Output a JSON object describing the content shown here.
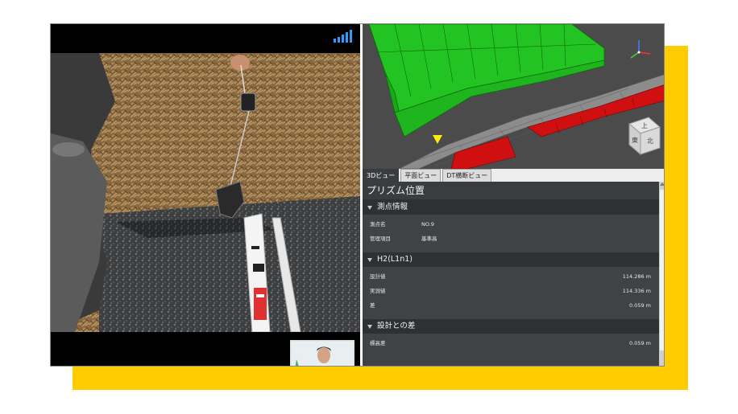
{
  "colors": {
    "accent": "#ffcc00",
    "frame_bg": "#000000",
    "panel_bg": "#404346",
    "section_bg": "#2e3133",
    "surface_green": "#1ec41e",
    "surface_red": "#d01010",
    "road_grey": "#8c8c8c",
    "marker_yellow": "#ffee00",
    "signal_blue": "#2f9bff"
  },
  "video": {
    "signal_icon": "signal-bars-icon",
    "pip": "presenter-thumbnail"
  },
  "viewport": {
    "view_cube": {
      "top": "上",
      "left": "東",
      "right": "北"
    },
    "axis_icon": "xyz-axis-gizmo-icon",
    "marker_icon": "yellow-triangle-marker-icon"
  },
  "tabs": [
    {
      "label": "3Dビュー",
      "active": true
    },
    {
      "label": "平面ビュー",
      "active": false
    },
    {
      "label": "DT横断ビュー",
      "active": false
    }
  ],
  "panel": {
    "title": "プリズム位置",
    "sections": [
      {
        "title": "測点情報",
        "rows": [
          {
            "label": "測点名",
            "value": "NO.9"
          },
          {
            "label": "管理項目",
            "value": "基準高"
          }
        ]
      },
      {
        "title": "H2(L1n1)",
        "rows": [
          {
            "label": "設計値",
            "value": "114.286 m"
          },
          {
            "label": "実測値",
            "value": "114.336 m"
          },
          {
            "label": "差",
            "value": "0.059 m"
          }
        ]
      },
      {
        "title": "設計との差",
        "rows": [
          {
            "label": "標高差",
            "value": "0.059 m"
          }
        ]
      }
    ]
  }
}
